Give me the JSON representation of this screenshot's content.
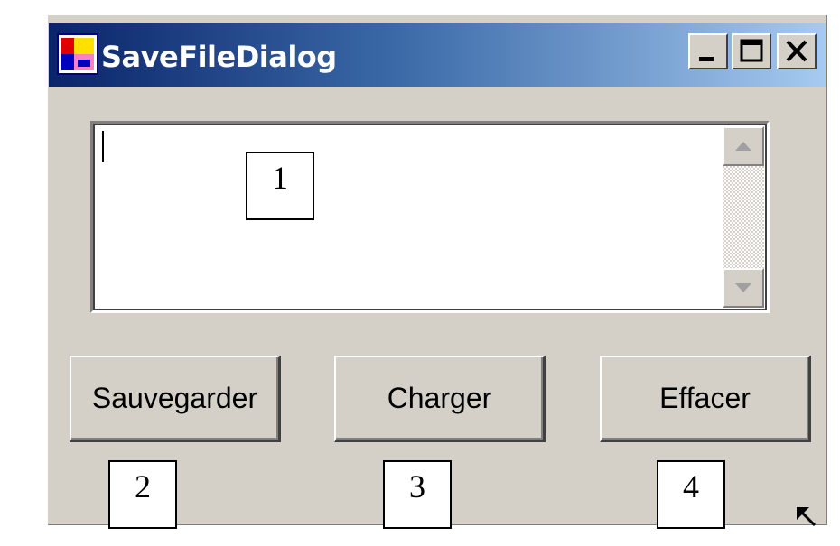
{
  "window": {
    "title": "SaveFileDialog",
    "icon": "winforms-app-icon",
    "controls": {
      "minimize": "minimize-icon",
      "maximize": "maximize-icon",
      "close": "close-icon"
    }
  },
  "textbox": {
    "value": "",
    "scrollbar": {
      "up": "scroll-up-arrow-icon",
      "down": "scroll-down-arrow-icon"
    }
  },
  "buttons": {
    "save": "Sauvegarder",
    "load": "Charger",
    "clear": "Effacer"
  },
  "callouts": {
    "one": "1",
    "two": "2",
    "three": "3",
    "four": "4"
  },
  "colors": {
    "titlebar_start": "#0a246a",
    "titlebar_end": "#a6caf0",
    "face": "#d4d0c8"
  }
}
